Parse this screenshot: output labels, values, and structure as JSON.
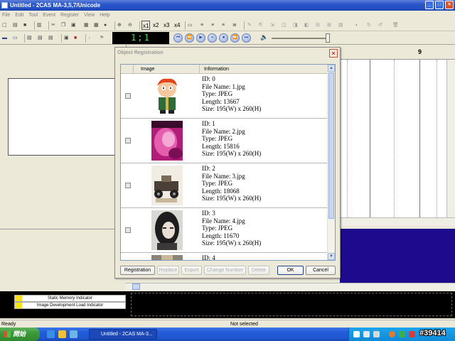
{
  "window": {
    "title": "Untitled - 2CAS MA-3,5,7/Unicode",
    "buttons": {
      "minimize": "_",
      "maximize": "□",
      "close": "×"
    }
  },
  "menu": [
    "File",
    "Edit",
    "Tool",
    "Event",
    "Register",
    "View",
    "Help"
  ],
  "toolbar": {
    "zoom": [
      "x1",
      "x2",
      "x3",
      "x4"
    ],
    "counter": "1;1"
  },
  "player": {
    "buttons": [
      "⏮",
      "⏪",
      "▶",
      "⏸",
      "⏹",
      "⏩",
      "⏭"
    ],
    "volume_level": 0.95
  },
  "right_panel": {
    "column_label": "9"
  },
  "indicators": {
    "static_memory": "Static Memory Indicator",
    "image_development": "Image Development Load Indicator"
  },
  "status": {
    "left": "Ready",
    "mid": "Not selected"
  },
  "taskbar": {
    "start_label": "開始",
    "task_item": "Untitled - 2CAS MA-3..."
  },
  "watermark": "#39414",
  "dialog": {
    "title": "Object Registration",
    "columns": {
      "image": "Image",
      "information": "Information"
    },
    "rows": [
      {
        "id": "ID: 0",
        "file": "File Name: 1.jpg",
        "type": "Type: JPEG",
        "length": "Length: 13667",
        "size": "Size: 195(W) x 260(H)",
        "thumb": "cartoon-character"
      },
      {
        "id": "ID: 1",
        "file": "File Name: 2.jpg",
        "type": "Type: JPEG",
        "length": "Length: 15816",
        "size": "Size: 195(W) x 260(H)",
        "thumb": "pink-portrait"
      },
      {
        "id": "ID: 2",
        "file": "File Name: 3.jpg",
        "type": "Type: JPEG",
        "length": "Length: 18068",
        "size": "Size: 195(W) x 260(H)",
        "thumb": "model-car"
      },
      {
        "id": "ID: 3",
        "file": "File Name: 4.jpg",
        "type": "Type: JPEG",
        "length": "Length: 11670",
        "size": "Size: 195(W) x 260(H)",
        "thumb": "girl-portrait"
      },
      {
        "id": "ID: 4"
      }
    ],
    "buttons": {
      "registration": "Registration",
      "replace": "Replace",
      "export": "Export",
      "change_number": "Change Number",
      "delete": "Delete",
      "ok": "OK",
      "cancel": "Cancel"
    }
  }
}
